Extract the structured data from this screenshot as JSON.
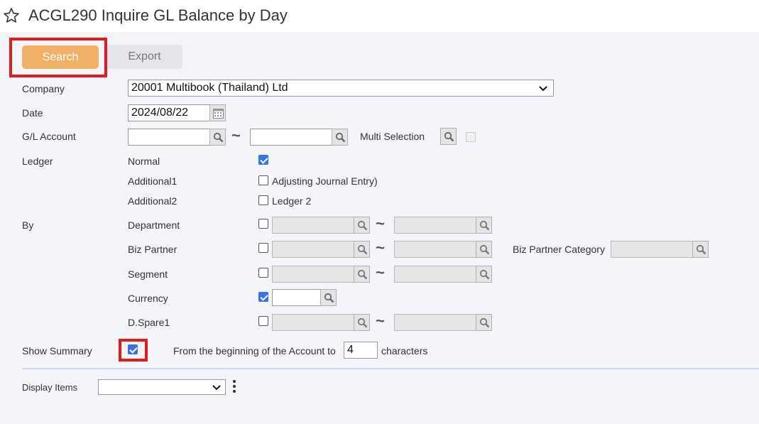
{
  "header": {
    "title": "ACGL290 Inquire GL Balance by Day"
  },
  "toolbar": {
    "search_label": "Search",
    "export_label": "Export"
  },
  "form": {
    "company_label": "Company",
    "company_value": "20001 Multibook (Thailand) Ltd",
    "date_label": "Date",
    "date_value": "2024/08/22",
    "gl_account_label": "G/L Account",
    "range_separator": "~",
    "multi_selection_label": "Multi Selection",
    "ledger_label": "Ledger",
    "ledger_rows": [
      {
        "label": "Normal",
        "checked": true,
        "option_text": ""
      },
      {
        "label": "Additional1",
        "checked": false,
        "option_text": "Adjusting Journal Entry)"
      },
      {
        "label": "Additional2",
        "checked": false,
        "option_text": "Ledger 2"
      }
    ],
    "by_label": "By",
    "by_rows": [
      {
        "label": "Department",
        "checked": false
      },
      {
        "label": "Biz Partner",
        "checked": false
      },
      {
        "label": "Segment",
        "checked": false
      },
      {
        "label": "Currency",
        "checked": true
      },
      {
        "label": "D.Spare1",
        "checked": false
      }
    ],
    "biz_partner_category_label": "Biz Partner Category",
    "show_summary_label": "Show Summary",
    "show_summary_checked": true,
    "summary_prefix": "From the beginning of the Account to",
    "summary_chars_value": "4",
    "summary_suffix": "characters",
    "display_items_label": "Display Items",
    "display_items_value": ""
  },
  "colors": {
    "search_button": "#f2b067",
    "highlight": "#e21b1b",
    "checkbox_checked": "#3b73e6"
  },
  "icons": [
    "star-icon",
    "chevron-down-icon",
    "calendar-icon",
    "search-icon",
    "kebab-menu-icon"
  ]
}
